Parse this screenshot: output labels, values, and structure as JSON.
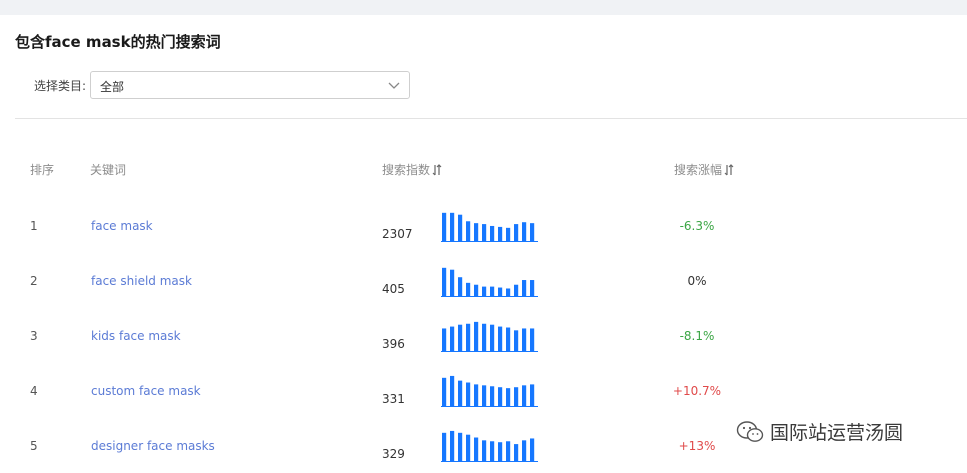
{
  "title": "包含face mask的热门搜索词",
  "filter": {
    "label": "选择类目:",
    "value": "全部"
  },
  "table": {
    "headers": {
      "rank": "排序",
      "keyword": "关键词",
      "index": "搜索指数",
      "change": "搜索涨幅"
    },
    "rows": [
      {
        "rank": "1",
        "keyword": "face mask",
        "index": "2307",
        "change": "-6.3%",
        "trend": "down",
        "spark": [
          30,
          30,
          28,
          21,
          19,
          18,
          16,
          15,
          14,
          18,
          20,
          19
        ]
      },
      {
        "rank": "2",
        "keyword": "face shield mask",
        "index": "405",
        "change": "0%",
        "trend": "flat",
        "spark": [
          30,
          28,
          20,
          14,
          12,
          10,
          10,
          9,
          8,
          12,
          17,
          17
        ]
      },
      {
        "rank": "3",
        "keyword": "kids face mask",
        "index": "396",
        "change": "-8.1%",
        "trend": "down",
        "spark": [
          24,
          26,
          28,
          29,
          31,
          29,
          28,
          26,
          25,
          22,
          24,
          24
        ]
      },
      {
        "rank": "4",
        "keyword": "custom face mask",
        "index": "331",
        "change": "+10.7%",
        "trend": "up",
        "spark": [
          30,
          32,
          27,
          25,
          23,
          22,
          21,
          20,
          19,
          20,
          22,
          23
        ]
      },
      {
        "rank": "5",
        "keyword": "designer face masks",
        "index": "329",
        "change": "+13%",
        "trend": "up",
        "spark": [
          30,
          32,
          30,
          28,
          25,
          22,
          21,
          20,
          21,
          18,
          22,
          24
        ]
      }
    ]
  },
  "colors": {
    "bar": "#1677ff",
    "up": "#e04a4a",
    "down": "#3aa544",
    "flat": "#333333"
  },
  "watermark": {
    "text": "国际站运营汤圆",
    "icon": "wechat-icon"
  }
}
